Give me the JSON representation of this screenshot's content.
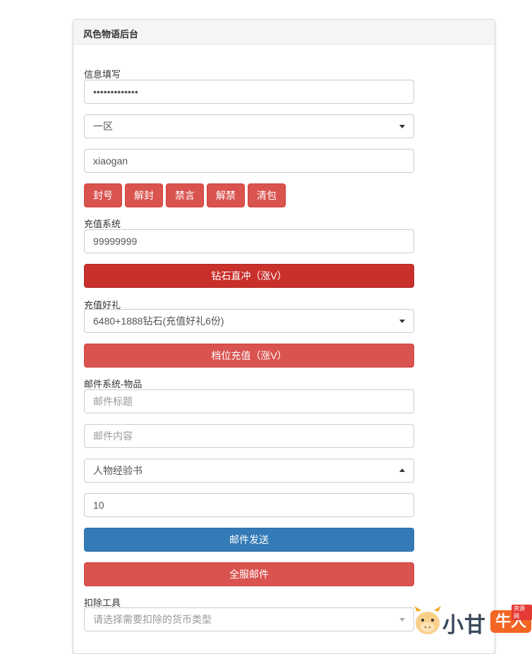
{
  "panel": {
    "title": "风色物语后台"
  },
  "info": {
    "label": "信息填写",
    "password_value": "•••••••••••••",
    "server_select": "一区",
    "username_value": "xiaogan"
  },
  "actions": [
    "封号",
    "解封",
    "禁言",
    "解禁",
    "清包"
  ],
  "recharge": {
    "label": "充值系统",
    "amount_value": "99999999",
    "button": "钻石直冲（涨V）"
  },
  "gift": {
    "label": "充值好礼",
    "select": "6480+1888钻石(充值好礼6份)",
    "button": "档位充值（涨V）"
  },
  "mail": {
    "label": "邮件系统-物品",
    "title_placeholder": "邮件标题",
    "content_placeholder": "邮件内容",
    "item_select": "人物经验书",
    "quantity_value": "10",
    "send_button": "邮件发送",
    "all_server_button": "全服邮件"
  },
  "deduct": {
    "label": "扣除工具",
    "select_placeholder": "请选择需要扣除的货币类型"
  },
  "watermark": {
    "text": "小甘",
    "badge": "牛人",
    "tag": "资源网"
  },
  "colors": {
    "danger": "#d9534f",
    "danger_dark": "#c9302c",
    "primary": "#337ab7"
  },
  "icons": {
    "select_caret": "caret-down-icon",
    "select_caret_open": "caret-up-icon",
    "logo": "calf-mascot-icon"
  }
}
